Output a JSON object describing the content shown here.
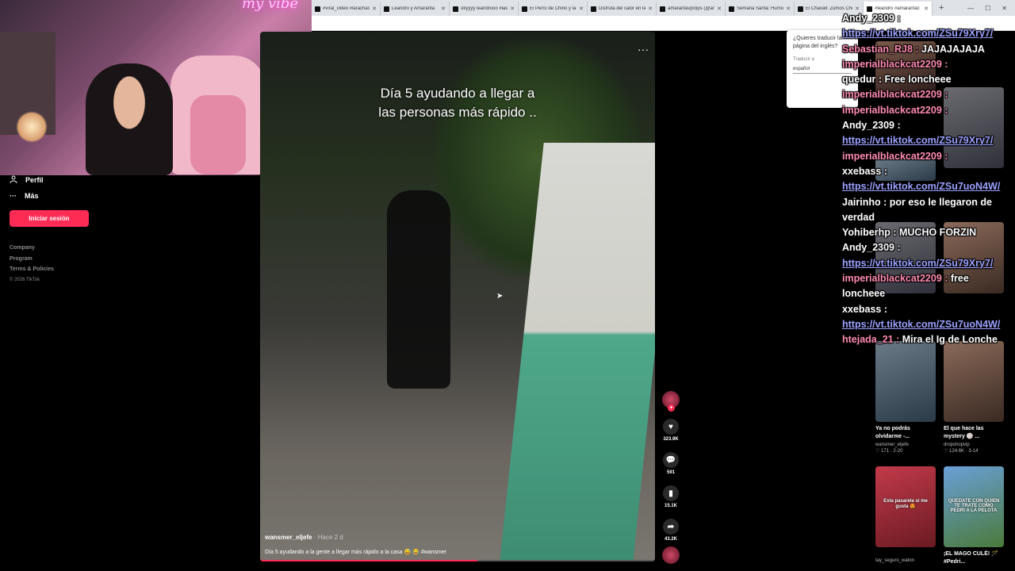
{
  "browser": {
    "tabs": [
      "#viral_video #larachas",
      "Leandro y Amaranta",
      "okyyyy leandrooo #las",
      "El Perro de Chino y la",
      "Disfruta del calor en la",
      "amarantavpclips (@am",
      "Semana Santa: Humor",
      "El Chavall: Zumos Che",
      "#leandro #amarantac"
    ],
    "new_tab": "+",
    "window_controls": [
      "—",
      "☐",
      "✕"
    ]
  },
  "webcam": {
    "neon_text": "my vibe"
  },
  "left_nav": {
    "profile_label": "Perfil",
    "more_label": "Más",
    "login_button": "Iniciar sesión",
    "footer_links": [
      "Company",
      "Program",
      "Terms & Policies"
    ],
    "copyright": "© 2026 TikTok"
  },
  "video": {
    "overlay_caption_line1": "Día 5 ayudando a llegar a",
    "overlay_caption_line2": "las personas más rápido ..",
    "author": "wansmer_eljefe",
    "time": "· Hace 2 d",
    "description": "Día 5 ayudando a la gente a llegar más rápido a la casa 😅 😂 #wansmer",
    "progress": 0.55
  },
  "actions": {
    "likes": "323.9K",
    "comments": "591",
    "saves": "15.1K",
    "shares": "43.2K"
  },
  "translate": {
    "question": "¿Quieres traducir la página del inglés?",
    "translate_to": "Traducir a",
    "language": "español"
  },
  "recommended": [
    {
      "title": "Ya no podrás olvidarme -...",
      "author": "wansmer_eljefe",
      "likes": "171",
      "date": "2-20",
      "thumb_text": ""
    },
    {
      "title": "El que hace las mystery 🏐 ...",
      "author": "dropshopvip",
      "likes": "124.6K",
      "date": "3-14",
      "thumb_text": ""
    },
    {
      "title": "",
      "author": "tay_seguro_waton",
      "likes": "",
      "date": "",
      "thumb_text": "Esta pasarela si me gusta 😍"
    },
    {
      "title": "¡EL MAGO CULÉ! 🪄 #Pedri...",
      "author": "",
      "likes": "",
      "date": "",
      "thumb_text": "QUEDATE CON QUIEN TE TRATE COMO PEDRI A LA PELOTA"
    }
  ],
  "chat": [
    {
      "user": "Andy_2309 :",
      "msg": "",
      "link": "https://vt.tiktok.com/ZSu79Xry7/"
    },
    {
      "user": "Sebastian_RJ8 :",
      "msg": "JAJAJAJAJA",
      "link": ""
    },
    {
      "user": "imperialblackcat2209 :",
      "msg": "",
      "link": ""
    },
    {
      "user": "quedur :",
      "msg": "Free loncheee",
      "link": ""
    },
    {
      "user": "imperialblackcat2209 :",
      "msg": "",
      "link": ""
    },
    {
      "user": "imperialblackcat2209 :",
      "msg": "",
      "link": ""
    },
    {
      "user": "Andy_2309 :",
      "msg": "",
      "link": "https://vt.tiktok.com/ZSu79Xry7/"
    },
    {
      "user": "imperialblackcat2209 :",
      "msg": "",
      "link": ""
    },
    {
      "user": "xxebass :",
      "msg": "",
      "link": "https://vt.tiktok.com/ZSu7uoN4W/"
    },
    {
      "user": "Jairinho :",
      "msg": "por eso le llegaron de verdad",
      "link": ""
    },
    {
      "user": "Yohiberhp :",
      "msg": "MUCHO FORZIN",
      "link": ""
    },
    {
      "user": "Andy_2309 :",
      "msg": "",
      "link": "https://vt.tiktok.com/ZSu79Xry7/"
    },
    {
      "user": "imperialblackcat2209 :",
      "msg": "free loncheee",
      "link": ""
    },
    {
      "user": "xxebass :",
      "msg": "",
      "link": "https://vt.tiktok.com/ZSu7uoN4W/"
    },
    {
      "user": "htejada_21 :",
      "msg": "Mira el Ig de Lonche",
      "link": ""
    }
  ],
  "colors": {
    "accent": "#fe2c55",
    "chat_link": "#9aa0ff",
    "chat_user_pink": "#ff8ab0"
  }
}
